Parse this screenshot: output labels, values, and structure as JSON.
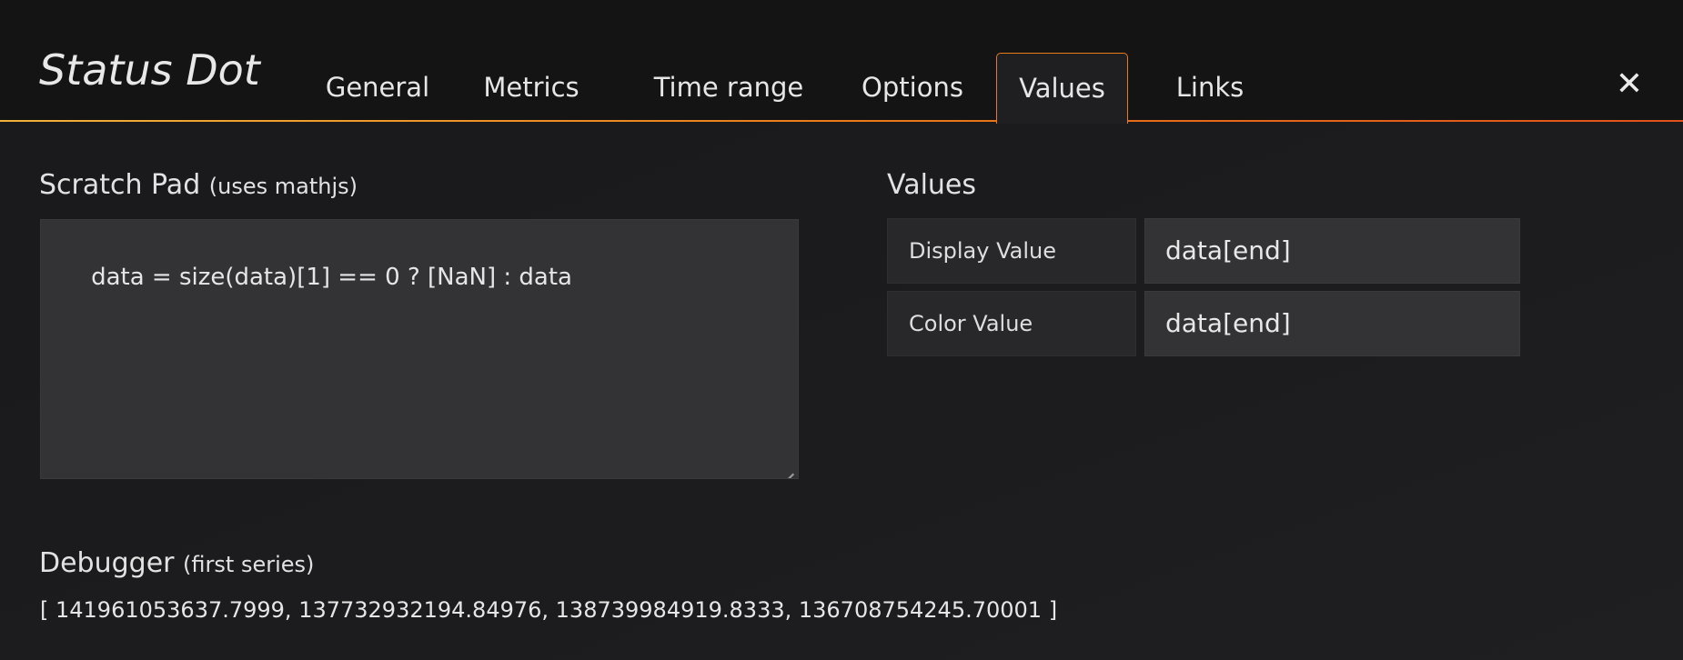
{
  "header": {
    "title": "Status Dot",
    "tabs": [
      "General",
      "Metrics",
      "Time range",
      "Options",
      "Values",
      "Links"
    ],
    "active_tab": "Values",
    "close_icon": "close-icon"
  },
  "scratch_pad": {
    "title": "Scratch Pad",
    "subtitle": "(uses mathjs)",
    "value": "data = size(data)[1] == 0 ? [NaN] : data"
  },
  "values": {
    "title": "Values",
    "rows": [
      {
        "label": "Display Value",
        "value": "data[end]"
      },
      {
        "label": "Color Value",
        "value": "data[end]"
      }
    ]
  },
  "debugger": {
    "title": "Debugger",
    "subtitle": "(first series)",
    "output": "[ 141961053637.7999, 137732932194.84976, 138739984919.8333, 136708754245.70001 ]"
  },
  "colors": {
    "background": "#161719",
    "accent_start": "#f2b13a",
    "accent_end": "#e0521b",
    "input_bg": "#333335"
  }
}
